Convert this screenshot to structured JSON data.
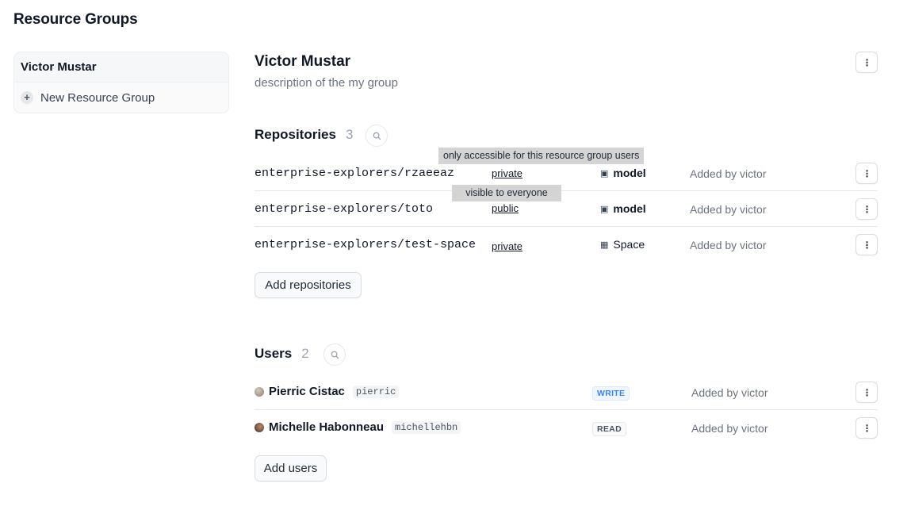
{
  "page": {
    "title": "Resource Groups"
  },
  "sidebar": {
    "items": [
      {
        "label": "Victor Mustar"
      },
      {
        "label": "New Resource Group",
        "icon": "plus-circle-icon"
      }
    ]
  },
  "group": {
    "name": "Victor Mustar",
    "description": "description of the my group"
  },
  "repositories": {
    "title": "Repositories",
    "count": "3",
    "add_label": "Add repositories",
    "items": [
      {
        "name": "enterprise-explorers/rzaeeaz",
        "visibility": "private",
        "type": "model",
        "type_icon": "cube-icon",
        "added_by": "Added by victor"
      },
      {
        "name": "enterprise-explorers/toto",
        "visibility": "public",
        "type": "model",
        "type_icon": "cube-icon",
        "added_by": "Added by victor"
      },
      {
        "name": "enterprise-explorers/test-space",
        "visibility": "private",
        "type": "Space",
        "type_icon": "grid-icon",
        "added_by": "Added by victor"
      }
    ],
    "tooltips": {
      "private": "only accessible for this resource group users",
      "public": "visible to everyone"
    }
  },
  "users": {
    "title": "Users",
    "count": "2",
    "add_label": "Add users",
    "items": [
      {
        "name": "Pierric Cistac",
        "handle": "pierric",
        "role": "WRITE",
        "added_by": "Added by victor"
      },
      {
        "name": "Michelle Habonneau",
        "handle": "michellehbn",
        "role": "READ",
        "added_by": "Added by victor"
      }
    ]
  },
  "colors": {
    "accent_write": "#3b82f6",
    "muted_text": "#6b7280",
    "tooltip_bg": "#d4d4d4"
  }
}
